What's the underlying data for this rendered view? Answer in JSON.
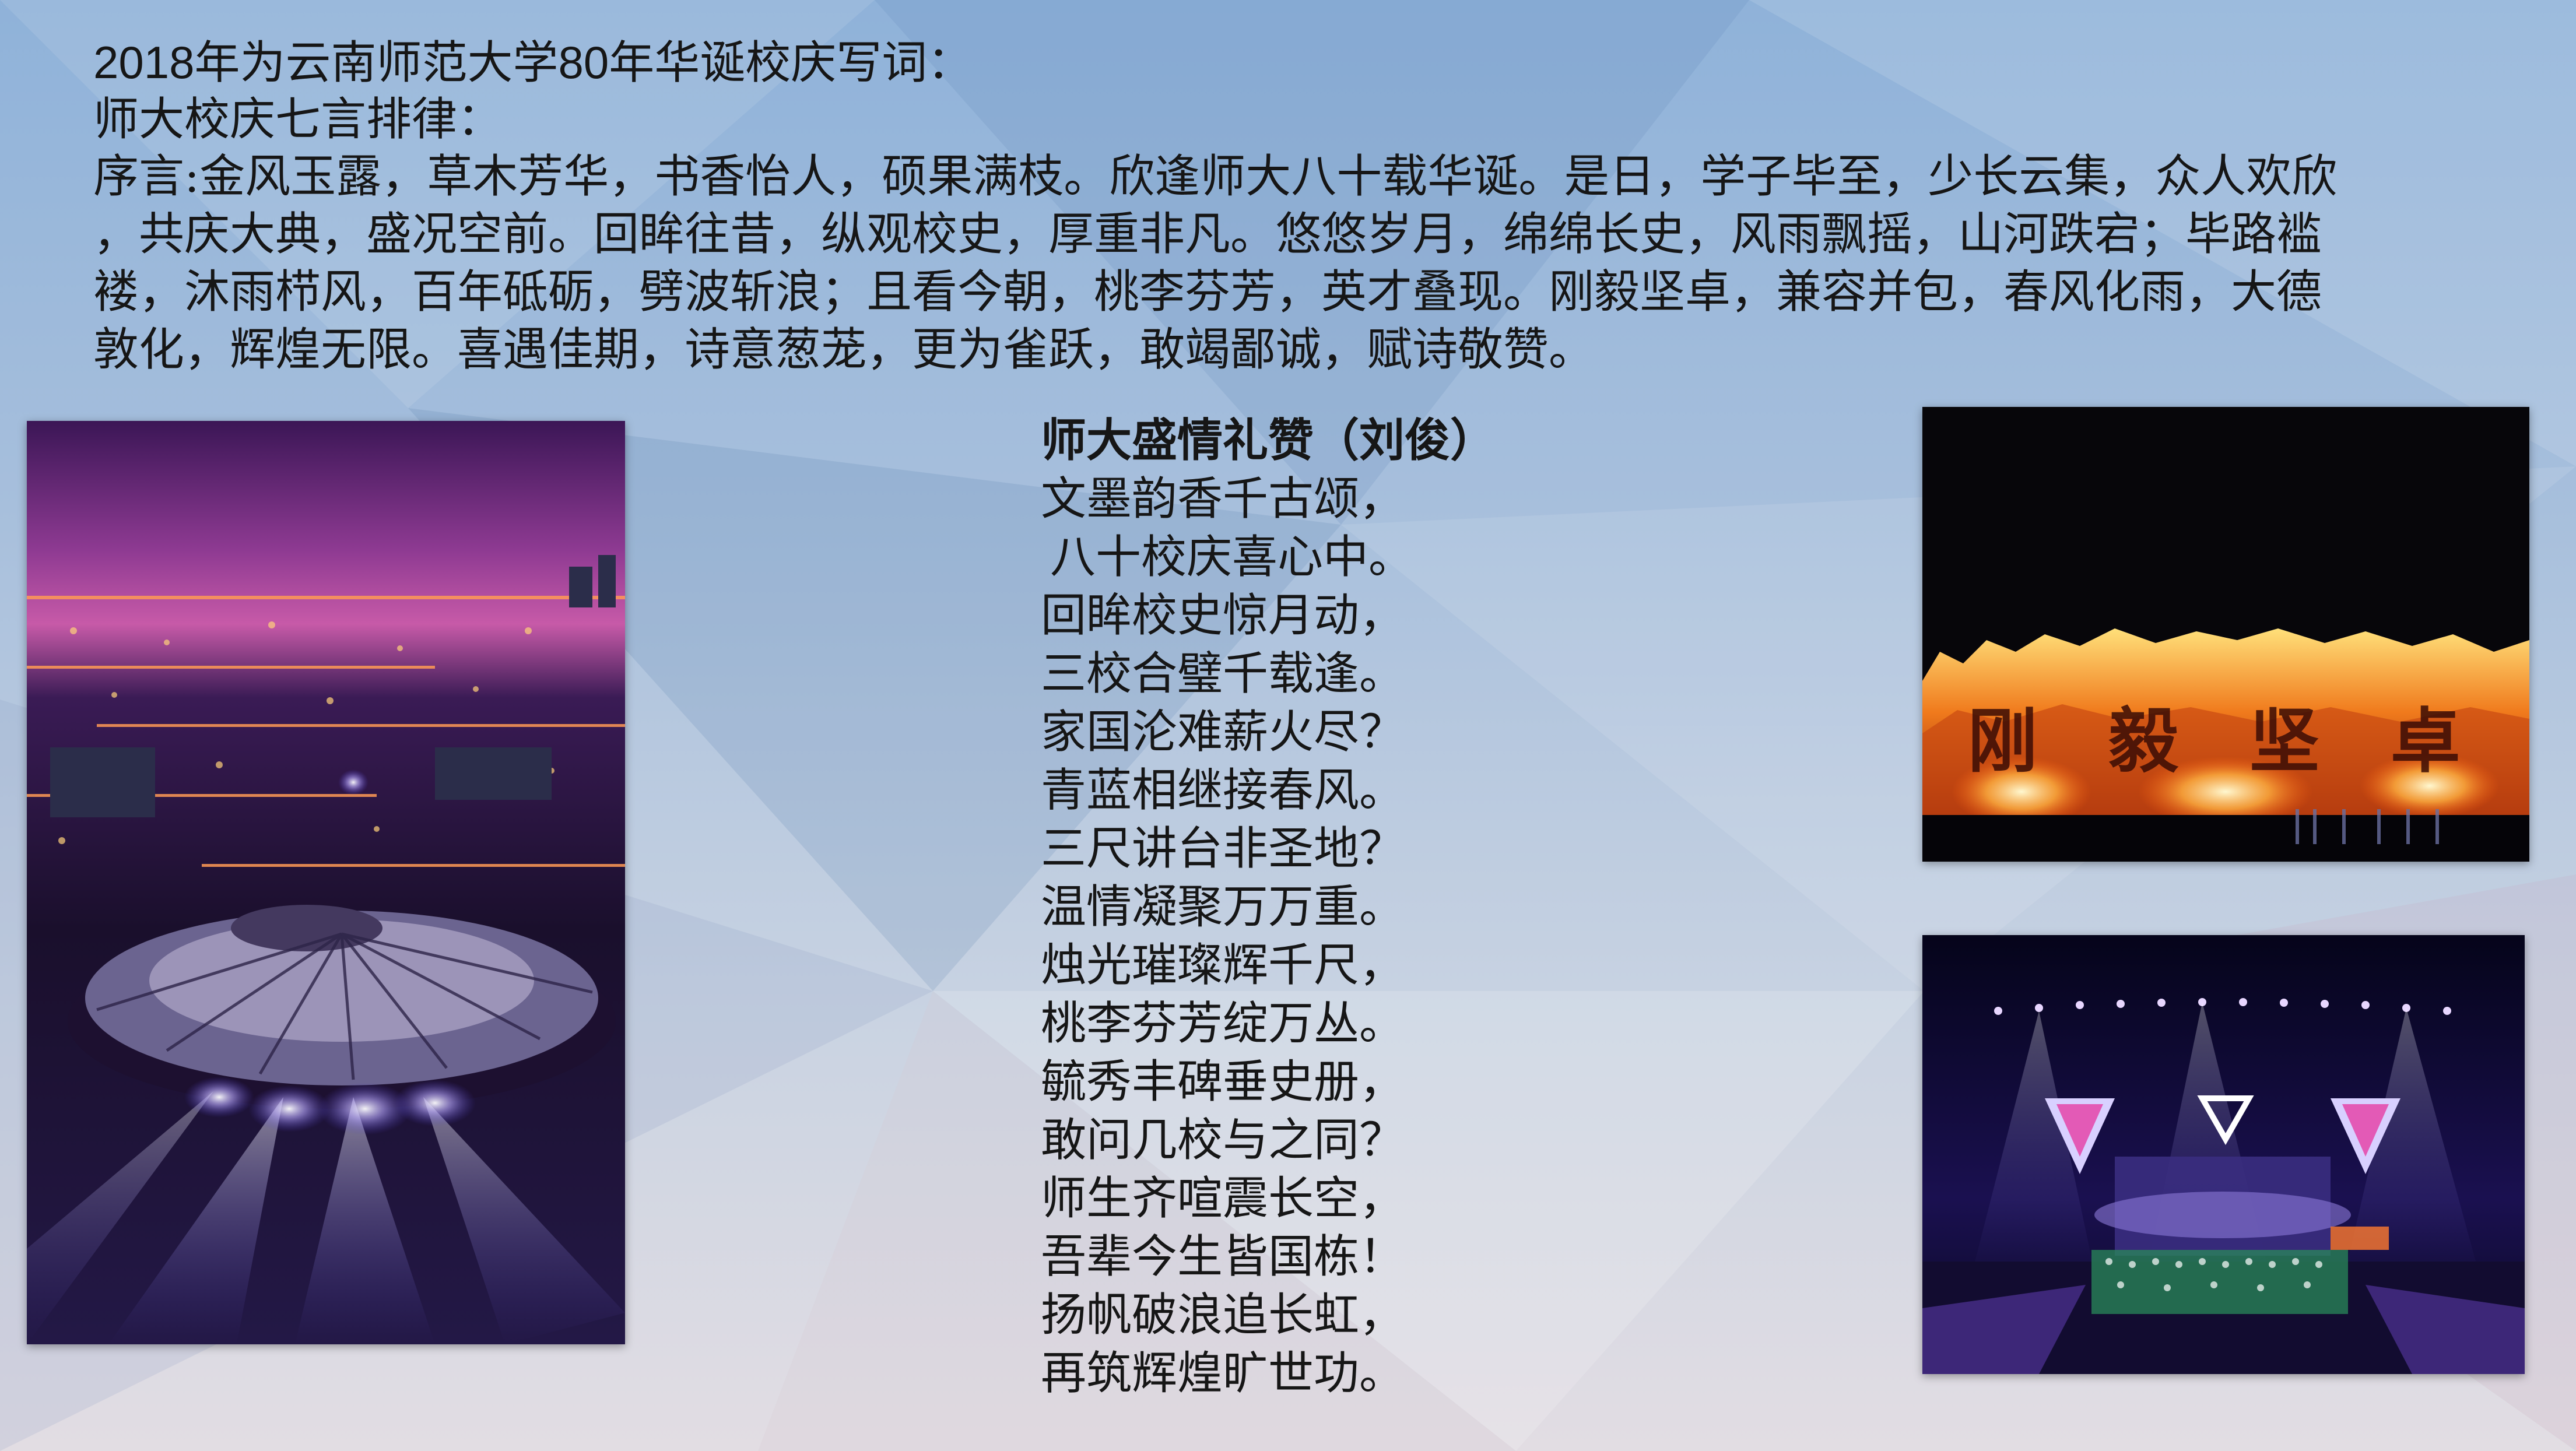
{
  "intro": {
    "heading": "2018年为云南师范大学80年华诞校庆写词：",
    "subheading": "师大校庆七言排律：",
    "preface_lines": [
      "序言:金风玉露，草木芳华，书香怡人，硕果满枝。欣逢师大八十载华诞。是日，学子毕至，少长云集，众人欢欣",
      "，共庆大典，盛况空前。回眸往昔，纵观校史，厚重非凡。悠悠岁月，绵绵长史，风雨飘摇，山河跌宕；毕路褴",
      "褛，沐雨栉风，百年砥砺，劈波斩浪；且看今朝，桃李芬芳，英才叠现。刚毅坚卓，兼容并包，春风化雨，大德",
      "敦化，辉煌无限。喜遇佳期，诗意葱茏，更为雀跃，敢竭鄙诚，赋诗敬赞。"
    ]
  },
  "poem": {
    "title": "师大盛情礼赞（刘俊）",
    "verses": [
      "文墨韵香千古颂，",
      "八十校庆喜心中。",
      "回眸校史惊月动，",
      "三校合璧千载逢。",
      "家国沦难薪火尽？",
      "青蓝相继接春风。",
      "三尺讲台非圣地？",
      "温情凝聚万万重。",
      "烛光璀璨辉千尺，",
      "桃李芬芳绽万丛。",
      "毓秀丰碑垂史册，",
      "敢问几校与之同？",
      "师生齐喧震长空，",
      "吾辈今生皆国栋！",
      "扬帆破浪追长虹，",
      "再筑辉煌旷世功。"
    ]
  },
  "photos": {
    "fire_sign_text": "刚 毅 坚 卓"
  },
  "colors": {
    "background_top": "#8fb2d9",
    "background_bottom": "#e2dde3",
    "text": "#161616",
    "fire": "#f07a1c",
    "night_purple": "#5a2a8c"
  }
}
